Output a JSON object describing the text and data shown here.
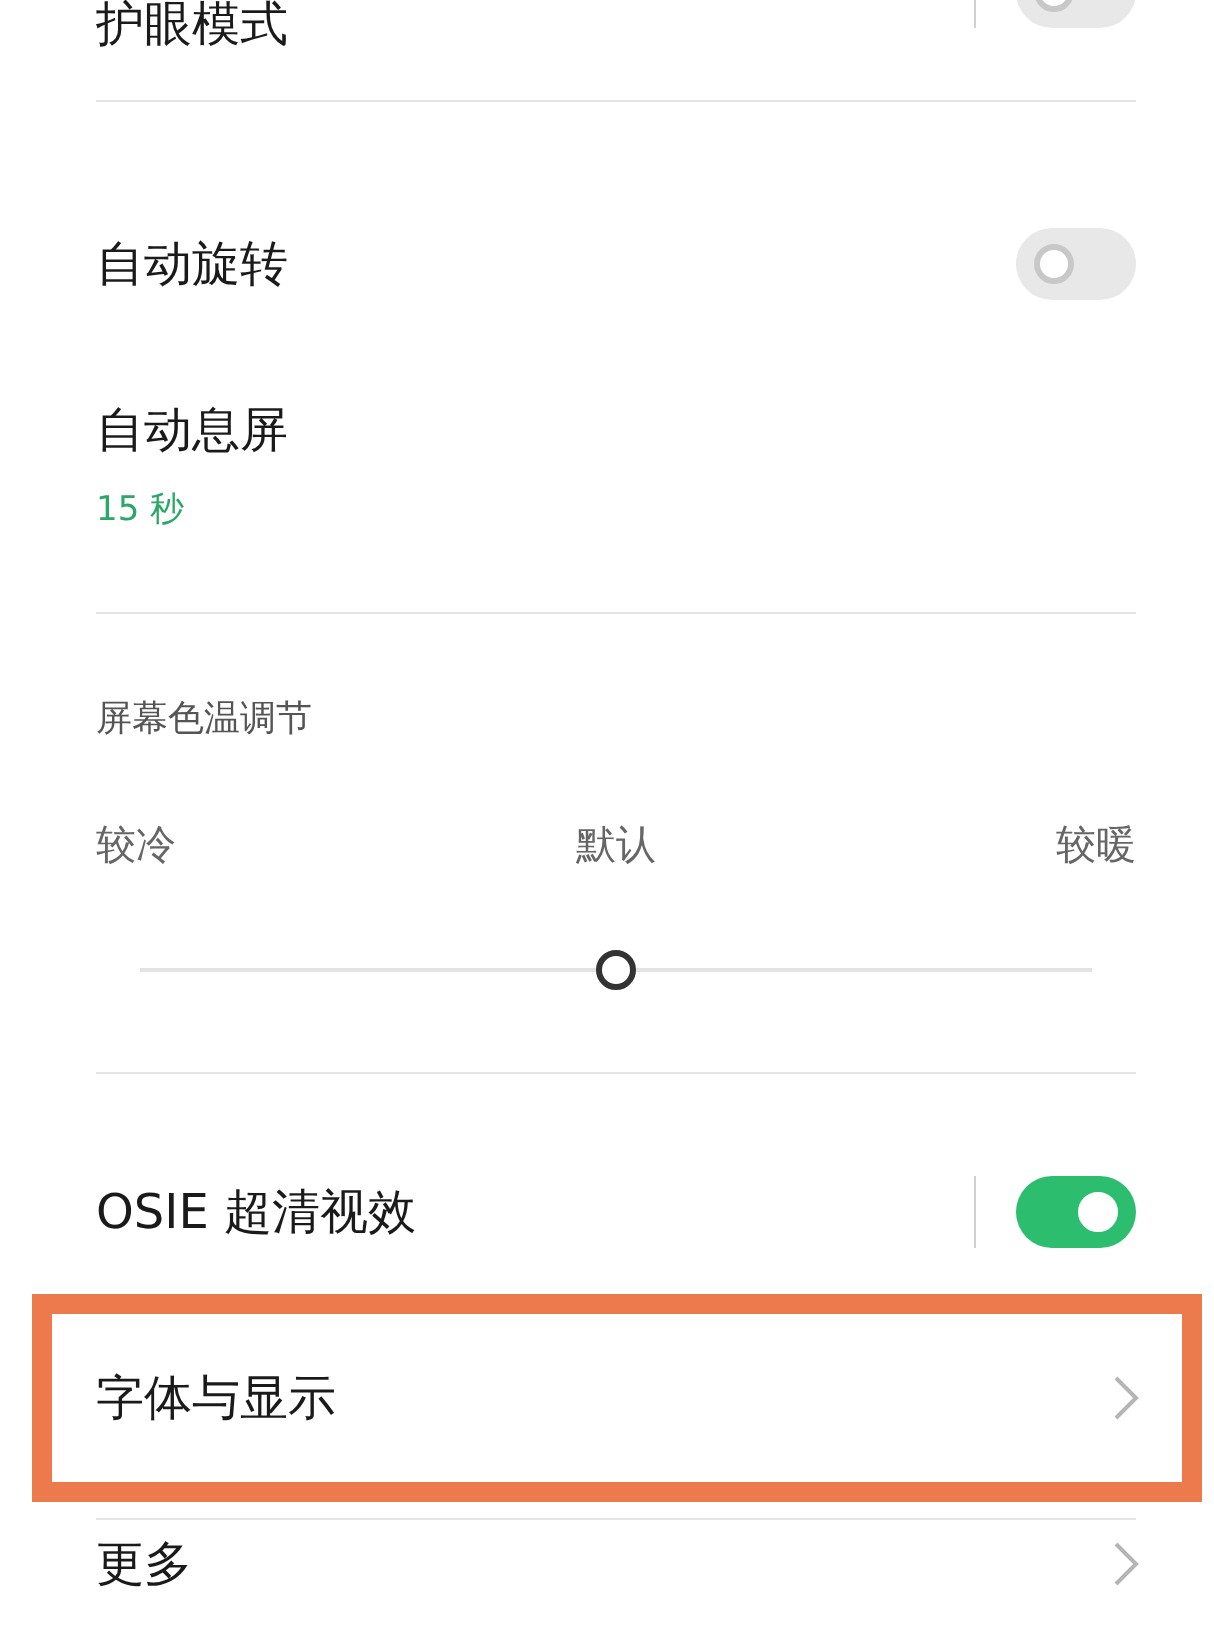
{
  "groups": [
    [
      {
        "kind": "toggle",
        "label": "护眼模式",
        "on": false,
        "separator": true
      }
    ],
    [
      {
        "kind": "toggle",
        "label": "自动旋转",
        "on": false,
        "separator": false
      },
      {
        "kind": "value",
        "label": "自动息屏",
        "value": "15 秒"
      }
    ],
    [
      {
        "kind": "slider",
        "title": "屏幕色温调节",
        "labels": [
          "较冷",
          "默认",
          "较暖"
        ],
        "level": 0.5
      }
    ],
    [
      {
        "kind": "toggle",
        "label": "OSIE 超清视效",
        "on": true,
        "separator": true
      },
      {
        "kind": "link",
        "label": "字体与显示",
        "highlighted": true
      }
    ],
    [
      {
        "kind": "link",
        "label": "更多",
        "highlighted": false
      }
    ]
  ]
}
